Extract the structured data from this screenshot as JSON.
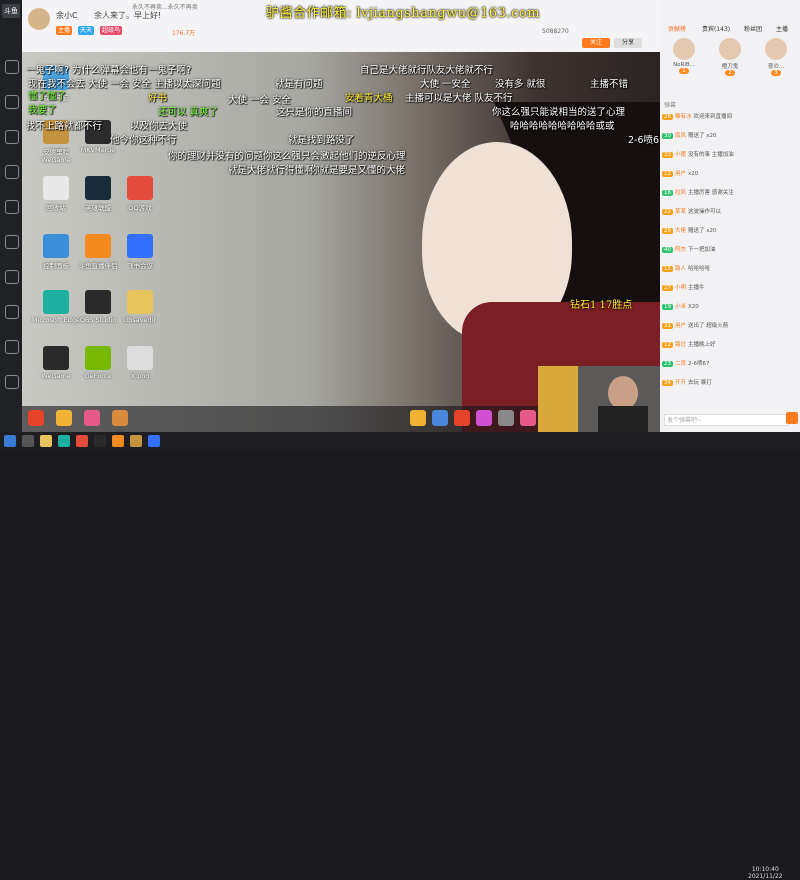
{
  "header": {
    "streamer_name": "余小C",
    "welcome": "余人来了。早上好!",
    "room_title": "永久不再卖...永久不再卖",
    "host_stats": "176.7万",
    "room_number": "5088270",
    "badges": [
      "主播",
      "天天",
      "超级鸟"
    ],
    "follow_label": "关注",
    "share_label": "分享",
    "watermark": "驴酱合作邮箱: lvjiangshangwu@163.com"
  },
  "desktop": {
    "icons": [
      {
        "label": "我的电脑",
        "name": "my-computer-icon",
        "color": "#4aa3df"
      },
      {
        "label": "安德里程 WeGame",
        "name": "wegame-icon",
        "color": "#c4933f"
      },
      {
        "label": "MKVMerge",
        "name": "mkvmerge-icon",
        "color": "#2b2b2b"
      },
      {
        "label": "回收站",
        "name": "recycle-bin-icon",
        "color": "#e8e8e8"
      },
      {
        "label": "英雄联盟",
        "name": "lol-icon",
        "color": "#1a2b3c"
      },
      {
        "label": "QQ游戏",
        "name": "qq-game-icon",
        "color": "#e34b3b"
      },
      {
        "label": "控制面板",
        "name": "control-panel-icon",
        "color": "#3b8ed8"
      },
      {
        "label": "斗鱼直播伴侣",
        "name": "douyu-assistant-icon",
        "color": "#f28a1f"
      },
      {
        "label": "飞书会议",
        "name": "feishu-icon",
        "color": "#3370ff"
      },
      {
        "label": "Microsoft Edge",
        "name": "edge-icon",
        "color": "#1bb0a0"
      },
      {
        "label": "OBS Studio",
        "name": "obs-icon",
        "color": "#2a2a2a"
      },
      {
        "label": "dbsavedir",
        "name": "folder-icon",
        "color": "#e8c25a"
      },
      {
        "label": "WeGame",
        "name": "wegame-icon-2",
        "color": "#2a2a2a"
      },
      {
        "label": "GeForce",
        "name": "geforce-icon",
        "color": "#76b900"
      },
      {
        "label": "X.png",
        "name": "image-file-icon",
        "color": "#dcdcdc"
      }
    ],
    "diamond_text": "钻石1 17胜点"
  },
  "danmaku": [
    {
      "text": "一鬼子啊? 为什么弹幕会也有一鬼子啊?",
      "color": "w"
    },
    {
      "text": "自己是大佬就行队友大佬就不行",
      "color": "w"
    },
    {
      "text": "现在我不会去 大使 一会 安全 主播以太深问题",
      "color": "w"
    },
    {
      "text": "懂了懂了",
      "color": "g"
    },
    {
      "text": "大使 一会 安全",
      "color": "w"
    },
    {
      "text": "就是有问题",
      "color": "w"
    },
    {
      "text": "大使 一安全",
      "color": "w"
    },
    {
      "text": "没有多 就很",
      "color": "w"
    },
    {
      "text": "主播不错",
      "color": "w"
    },
    {
      "text": "好书",
      "color": "y"
    },
    {
      "text": "安着青大桶",
      "color": "y"
    },
    {
      "text": "主播可以是大佬 队友不行",
      "color": "w"
    },
    {
      "text": "我要了",
      "color": "g"
    },
    {
      "text": "还可以 真爽了",
      "color": "g"
    },
    {
      "text": "这只是你的直播间",
      "color": "w"
    },
    {
      "text": "你这么强只能说相当的送了心理",
      "color": "w"
    },
    {
      "text": "找不上路就都不行",
      "color": "w"
    },
    {
      "text": "以及你去大使",
      "color": "w"
    },
    {
      "text": "哈哈哈哈哈哈哈哈哈或或",
      "color": "w"
    },
    {
      "text": "他今你这种不行",
      "color": "w"
    },
    {
      "text": "就是找到路没了",
      "color": "w"
    },
    {
      "text": "2-6喷6",
      "color": "w"
    },
    {
      "text": "你的理财并没有的问题你这么强只会激起他们的逆反心理",
      "color": "w"
    },
    {
      "text": "就是大佬就行得懂啊",
      "color": "w"
    },
    {
      "text": "你就是要是又懂的大佬",
      "color": "w"
    }
  ],
  "right_panel": {
    "tabs": [
      "贡献榜",
      "贵宾(143)",
      "粉丝团",
      "主播"
    ],
    "top_ranks": [
      {
        "name": "NoRiB...",
        "badge": "1"
      },
      {
        "name": "橙刀鬼",
        "badge": "2"
      },
      {
        "name": "夜の...",
        "badge": "3"
      }
    ],
    "chat_label": "弹幕",
    "messages": [
      {
        "level": "26",
        "nick": "稀有冰",
        "text": "欢迎来到直播间"
      },
      {
        "level": "30",
        "nick": "南风",
        "text": "赠送了 x20"
      },
      {
        "level": "33",
        "nick": "小猪",
        "text": "没有的事 主播加油"
      },
      {
        "level": "12",
        "nick": "用户",
        "text": "x20"
      },
      {
        "level": "18",
        "nick": "拉风",
        "text": "主播厉害 感谢关注"
      },
      {
        "level": "22",
        "nick": "某某",
        "text": "这波操作可以"
      },
      {
        "level": "25",
        "nick": "大佬",
        "text": "赠送了 x20"
      },
      {
        "level": "40",
        "nick": "阿杰",
        "text": "下一把加油"
      },
      {
        "level": "15",
        "nick": "路人",
        "text": "哈哈哈哈"
      },
      {
        "level": "27",
        "nick": "小明",
        "text": "主播牛"
      },
      {
        "level": "19",
        "nick": "小米",
        "text": "X20"
      },
      {
        "level": "31",
        "nick": "用户",
        "text": "送出了 超级火箭"
      },
      {
        "level": "12",
        "nick": "路过",
        "text": "主播晚上好"
      },
      {
        "level": "23",
        "nick": "二货",
        "text": "2-6喷67"
      },
      {
        "level": "34",
        "nick": "开开",
        "text": "去玩 暴打"
      }
    ],
    "chat_placeholder": "发个弹幕吧~",
    "clock": "10:10:40",
    "date": "2021/11/22"
  }
}
